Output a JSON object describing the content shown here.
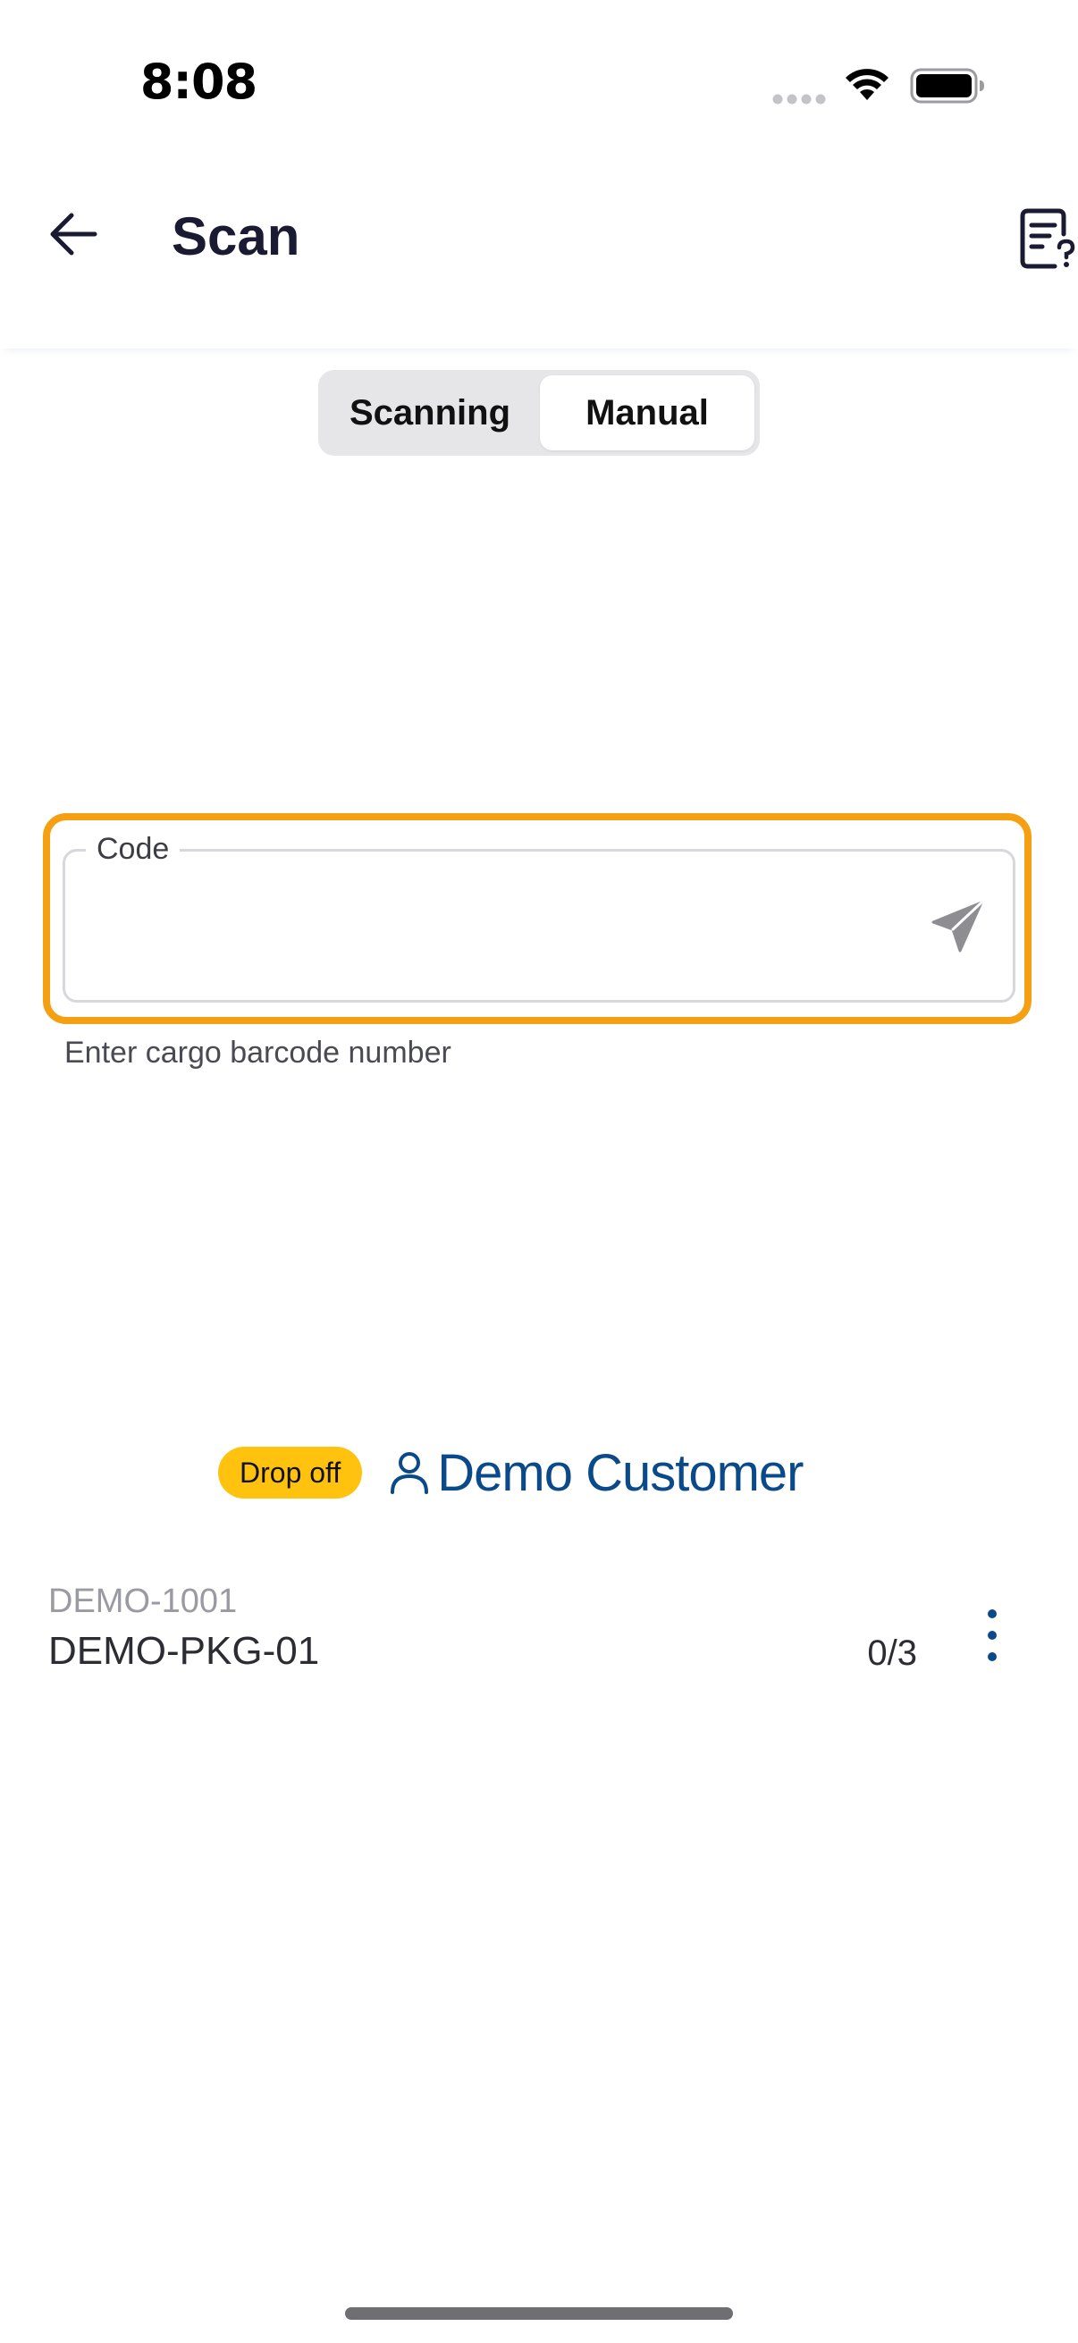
{
  "status_bar": {
    "time": "8:08",
    "icons": [
      "signal-dots-icon",
      "wifi-icon",
      "battery-icon"
    ]
  },
  "header": {
    "title": "Scan",
    "back_icon": "arrow-left-icon",
    "right_icon": "document-question-icon"
  },
  "mode_tabs": {
    "options": [
      "Scanning",
      "Manual"
    ],
    "selected": "Manual"
  },
  "code_field": {
    "label": "Code",
    "value": "",
    "helper": "Enter cargo barcode number",
    "submit_icon": "send-icon",
    "focus_color": "#f5a012"
  },
  "customer": {
    "badge": "Drop off",
    "badge_color": "#ffc20f",
    "icon": "person-icon",
    "name": "Demo Customer",
    "name_color": "#0b4a8a"
  },
  "items": [
    {
      "reference": "DEMO-1001",
      "name": "DEMO-PKG-01",
      "count": "0/3",
      "menu_icon": "more-vertical-icon"
    }
  ]
}
